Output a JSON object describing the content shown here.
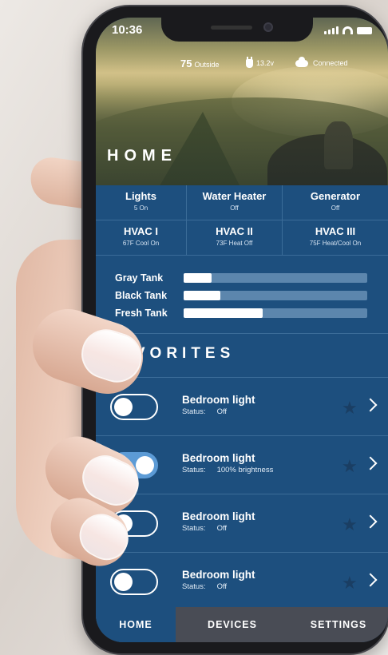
{
  "status_bar": {
    "time": "10:36"
  },
  "hero": {
    "temperature": "75",
    "temperature_label": "Outside",
    "voltage": "13.2v",
    "connection": "Connected",
    "title": "HOME"
  },
  "systems": [
    {
      "name": "Lights",
      "status": "5 On"
    },
    {
      "name": "Water Heater",
      "status": "Off"
    },
    {
      "name": "Generator",
      "status": "Off"
    },
    {
      "name": "HVAC I",
      "status": "67F Cool On"
    },
    {
      "name": "HVAC II",
      "status": "73F Heat Off"
    },
    {
      "name": "HVAC III",
      "status": "75F Heat/Cool On"
    }
  ],
  "tanks": [
    {
      "name": "Gray Tank",
      "level": 0.15
    },
    {
      "name": "Black Tank",
      "level": 0.2
    },
    {
      "name": "Fresh Tank",
      "level": 0.43
    }
  ],
  "favorites": {
    "heading": "FAVORITES",
    "items": [
      {
        "name": "Bedroom light",
        "status_label": "Status:",
        "status": "Off",
        "toggle": "off"
      },
      {
        "name": "Bedroom light",
        "status_label": "Status:",
        "status": "100% brightness",
        "toggle": "on"
      },
      {
        "name": "Bedroom light",
        "status_label": "Status:",
        "status": "Off",
        "toggle": "off"
      },
      {
        "name": "Bedroom light",
        "status_label": "Status:",
        "status": "Off",
        "toggle": "off"
      }
    ]
  },
  "tabs": {
    "home": "HOME",
    "devices": "DEVICES",
    "settings": "SETTINGS",
    "active": "home"
  },
  "colors": {
    "app_background": "#1d4f7e",
    "tab_bar": "#494c55",
    "toggle_on": "#5c9bd6",
    "star": "#1a3e63"
  }
}
